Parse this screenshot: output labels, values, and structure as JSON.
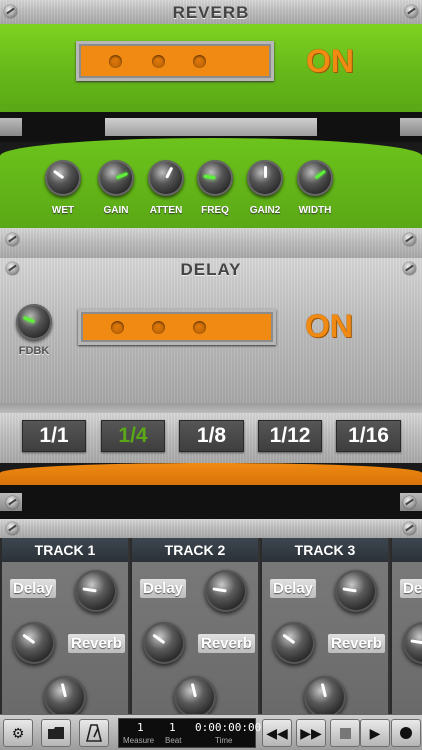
{
  "reverb": {
    "title": "REVERB",
    "status": "ON",
    "knobs": [
      {
        "label": "WET",
        "value": 0.3
      },
      {
        "label": "GAIN",
        "value": 0.75
      },
      {
        "label": "ATTEN",
        "value": 0.6
      },
      {
        "label": "FREQ",
        "value": 0.2
      },
      {
        "label": "GAIN2",
        "value": 0.5
      },
      {
        "label": "WIDTH",
        "value": 0.7
      }
    ]
  },
  "delay": {
    "title": "DELAY",
    "status": "ON",
    "fdbk": {
      "label": "FDBK",
      "value": 0.25
    },
    "rates": [
      "1/1",
      "1/4",
      "1/8",
      "1/12",
      "1/16"
    ],
    "active_rate": "1/4"
  },
  "mixer": {
    "tracks": [
      {
        "name": "TRACK 1",
        "delay_label": "Delay",
        "reverb_label": "Reverb"
      },
      {
        "name": "TRACK 2",
        "delay_label": "Delay",
        "reverb_label": "Reverb"
      },
      {
        "name": "TRACK 3",
        "delay_label": "Delay",
        "reverb_label": "Reverb"
      },
      {
        "name": "",
        "delay_label": "De",
        "reverb_label": ""
      }
    ]
  },
  "transport": {
    "measure": "1",
    "beat": "1",
    "time": "0:00:00:000",
    "measure_label": "Measure",
    "beat_label": "Beat",
    "time_label": "Time"
  },
  "colors": {
    "green": "#66b81a",
    "orange": "#f08a12",
    "active_rate": "#5aa816"
  }
}
